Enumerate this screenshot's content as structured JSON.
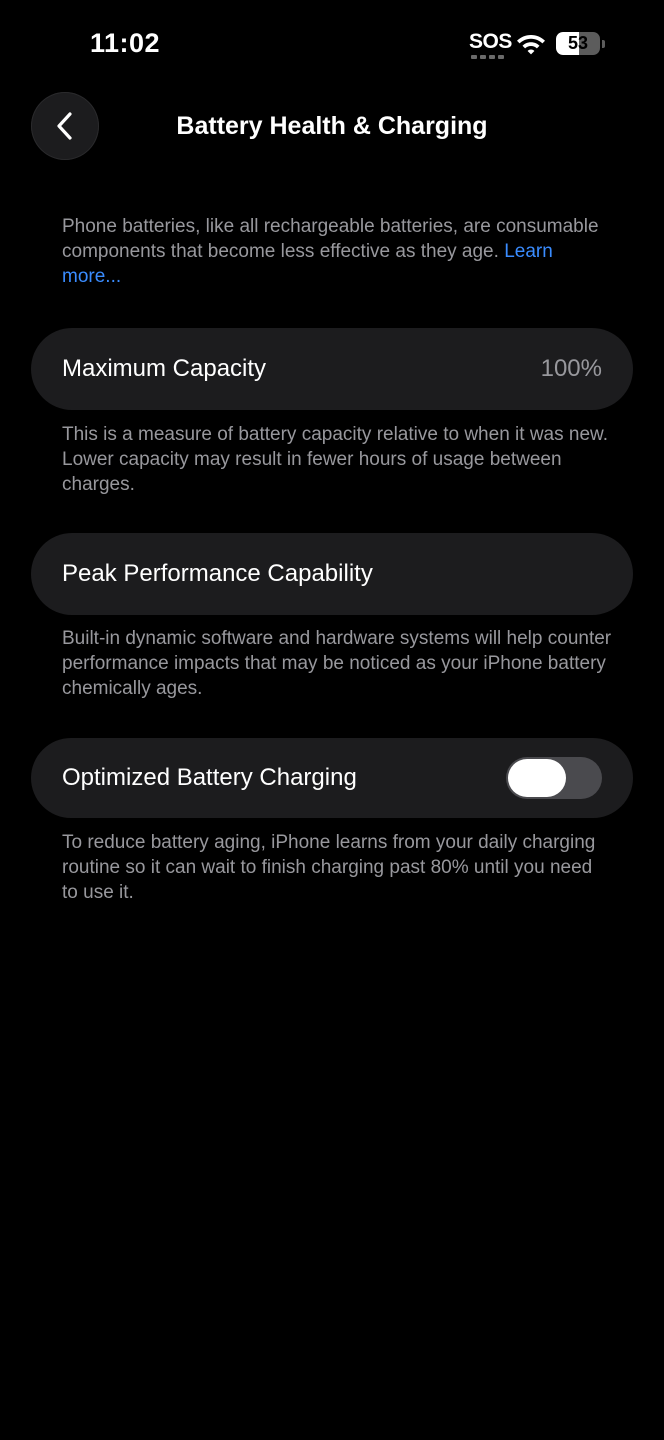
{
  "status_bar": {
    "time": "11:02",
    "carrier": "SOS",
    "wifi_icon": "wifi-icon",
    "battery_level": "53",
    "battery_fraction": 0.53
  },
  "nav": {
    "back_icon": "chevron-left-icon",
    "title": "Battery Health & Charging"
  },
  "intro": {
    "text": "Phone batteries, like all rechargeable batteries, are consumable components that become less effective as they age. ",
    "link": "Learn more..."
  },
  "maximum_capacity": {
    "label": "Maximum Capacity",
    "value": "100%",
    "footnote": "This is a measure of battery capacity relative to when it was new. Lower capacity may result in fewer hours of usage between charges."
  },
  "peak_performance": {
    "label": "Peak Performance Capability",
    "footnote": "Built-in dynamic software and hardware systems will help counter performance impacts that may be noticed as your iPhone battery chemically ages."
  },
  "optimized_charging": {
    "label": "Optimized Battery Charging",
    "enabled": false,
    "footnote": "To reduce battery aging, iPhone learns from your daily charging routine so it can wait to finish charging past 80% until you need to use it."
  },
  "colors": {
    "background": "#000000",
    "cell_background": "#1c1c1e",
    "secondary_text": "#98989d",
    "link": "#3a8cff",
    "toggle_off_track": "#4a4a4e"
  }
}
